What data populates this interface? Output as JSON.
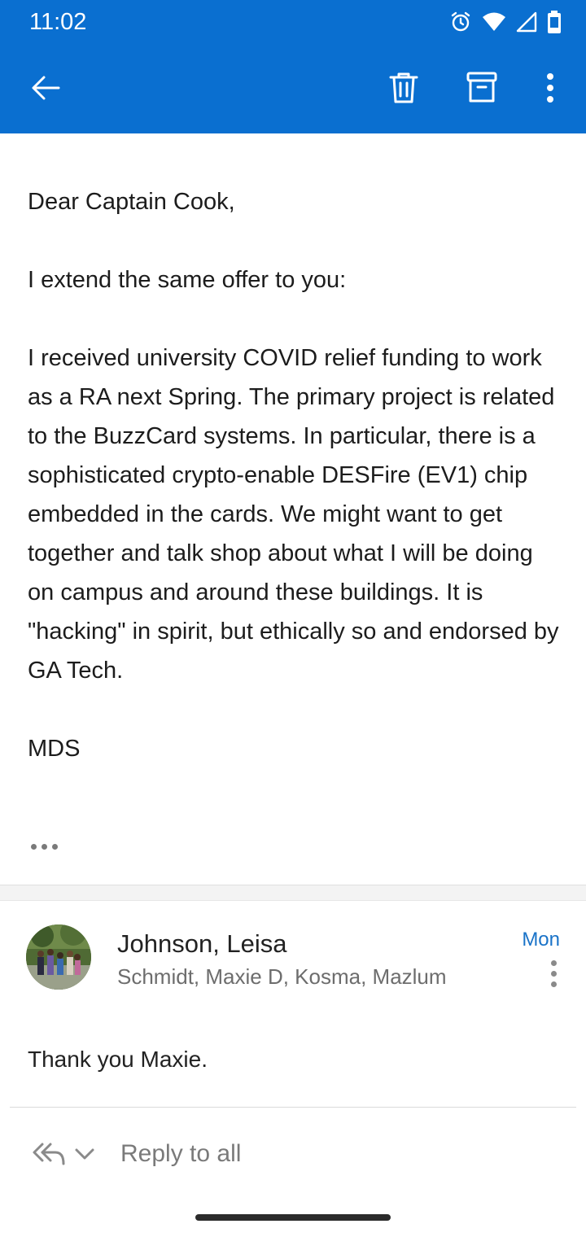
{
  "status_bar": {
    "time": "11:02",
    "icons": [
      "alarm-icon",
      "wifi-icon",
      "signal-icon",
      "battery-icon"
    ]
  },
  "toolbar": {
    "back_icon": "arrow-left-icon",
    "delete_icon": "trash-icon",
    "archive_icon": "archive-icon",
    "more_icon": "more-vertical-icon"
  },
  "message": {
    "greeting": "Dear Captain Cook,",
    "line_offer": "I extend the same offer to you:",
    "paragraph": "I received university COVID relief funding to work as a RA next Spring. The primary project is related to the BuzzCard systems. In particular, there is a sophisticated crypto-enable DESFire (EV1) chip embedded in the cards. We might want to get together and talk shop about what I will be doing on campus and around these buildings. It is \"hacking\" in spirit, but ethically so and endorsed by GA Tech.",
    "signature": "MDS"
  },
  "reply": {
    "sender": "Johnson, Leisa",
    "recipients": "Schmidt, Maxie D, Kosma, Mazlum",
    "date": "Mon",
    "body": "Thank you Maxie."
  },
  "action_bar": {
    "reply_to_all_label": "Reply to all"
  },
  "colors": {
    "app_bar": "#0a6fd0",
    "accent": "#1a73c8"
  }
}
